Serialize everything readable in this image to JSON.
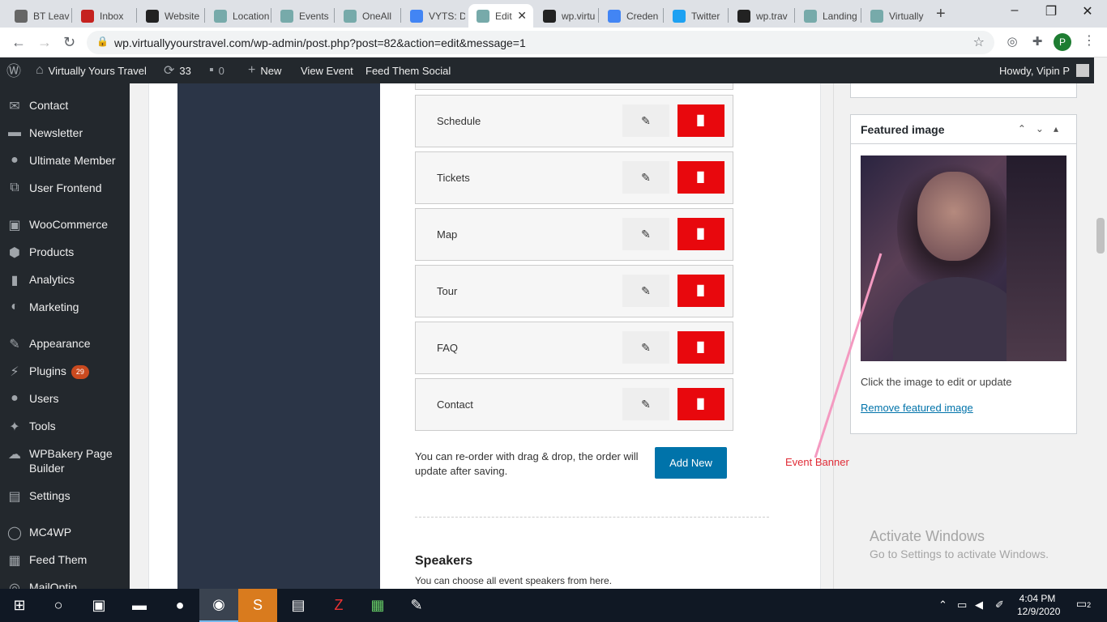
{
  "browser": {
    "tabs": [
      {
        "label": "BT Leav",
        "icon": "globe-icon"
      },
      {
        "label": "Inbox",
        "icon": "gmail-icon"
      },
      {
        "label": "Website",
        "icon": "website-icon"
      },
      {
        "label": "Location",
        "icon": "page-icon"
      },
      {
        "label": "Events",
        "icon": "page-icon"
      },
      {
        "label": "OneAll",
        "icon": "page-icon"
      },
      {
        "label": "VYTS: D",
        "icon": "docs-icon"
      },
      {
        "label": "Edit",
        "icon": "page-icon"
      },
      {
        "label": "wp.virtu",
        "icon": "terminal-icon"
      },
      {
        "label": "Creden",
        "icon": "google-icon"
      },
      {
        "label": "Twitter",
        "icon": "twitter-icon"
      },
      {
        "label": "wp.trav",
        "icon": "terminal-icon"
      },
      {
        "label": "Landing",
        "icon": "page-icon"
      },
      {
        "label": "Virtually",
        "icon": "page-icon"
      }
    ],
    "url": "wp.virtuallyyourstravel.com/wp-admin/post.php?post=82&action=edit&message=1",
    "profile_initial": "P"
  },
  "adminbar": {
    "site_name": "Virtually Yours Travel",
    "updates_count": "33",
    "comments_count": "0",
    "new_label": "New",
    "view_label": "View Event",
    "feed_label": "Feed Them Social",
    "howdy": "Howdy, Vipin P"
  },
  "sidebar": {
    "items": [
      {
        "label": "Contact",
        "icon": "envelope-icon"
      },
      {
        "label": "Newsletter",
        "icon": "mail-icon"
      },
      {
        "label": "Ultimate Member",
        "icon": "user-icon"
      },
      {
        "label": "User Frontend",
        "icon": "frontend-icon"
      },
      {
        "label": "WooCommerce",
        "icon": "woo-icon"
      },
      {
        "label": "Products",
        "icon": "box-icon"
      },
      {
        "label": "Analytics",
        "icon": "bar-chart-icon"
      },
      {
        "label": "Marketing",
        "icon": "megaphone-icon"
      },
      {
        "label": "Appearance",
        "icon": "brush-icon"
      },
      {
        "label": "Plugins",
        "icon": "plug-icon",
        "badge": "29"
      },
      {
        "label": "Users",
        "icon": "user-icon"
      },
      {
        "label": "Tools",
        "icon": "wrench-icon"
      },
      {
        "label": "WPBakery Page Builder",
        "icon": "cloud-icon"
      },
      {
        "label": "Settings",
        "icon": "settings-icon"
      },
      {
        "label": "MC4WP",
        "icon": "mc4wp-icon"
      },
      {
        "label": "Feed Them",
        "icon": "feed-icon"
      },
      {
        "label": "MailOptin",
        "icon": "mailoptin-icon"
      }
    ]
  },
  "tabs_editor": {
    "rows": [
      "Schedule",
      "Tickets",
      "Map",
      "Tour",
      "FAQ",
      "Contact"
    ],
    "reorder_text": "You can re-order with drag & drop, the order will update after saving.",
    "add_new": "Add New"
  },
  "speakers": {
    "title": "Speakers",
    "description": "You can choose all event speakers from here."
  },
  "featured_image": {
    "title": "Featured image",
    "click_text": "Click the image to edit or update",
    "remove_link": "Remove featured image"
  },
  "annotation": {
    "text": "Event Banner",
    "color": "#e02b36"
  },
  "watermark": {
    "line1": "Activate Windows",
    "line2": "Go to Settings to activate Windows."
  },
  "taskbar": {
    "time": "4:04 PM",
    "date": "12/9/2020",
    "notification_count": "2"
  }
}
